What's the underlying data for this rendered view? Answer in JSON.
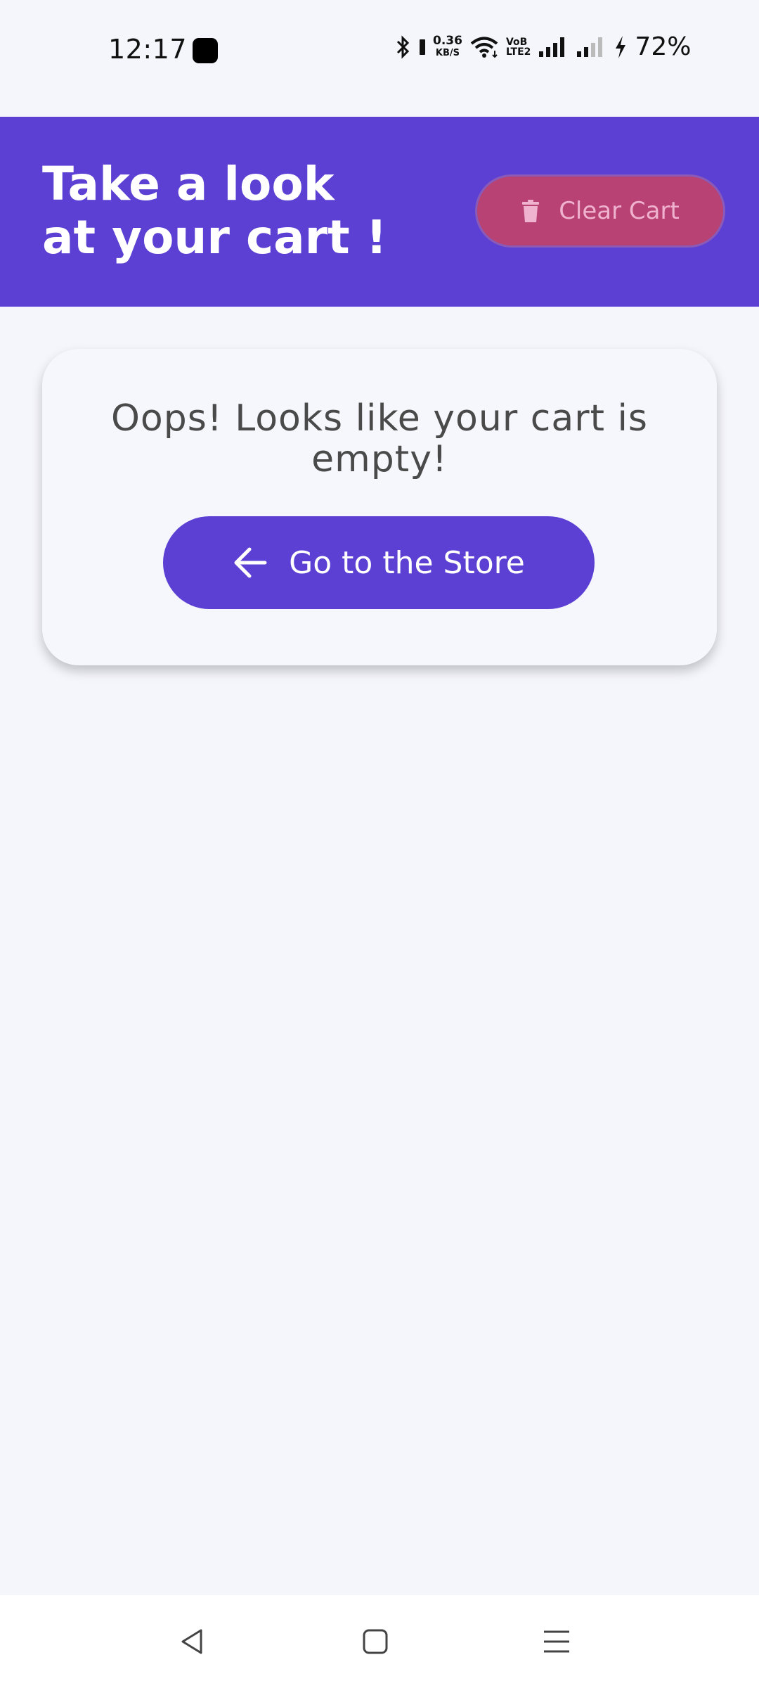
{
  "status_bar": {
    "time": "12:17",
    "net_speed_value": "0.36",
    "net_speed_unit": "KB/S",
    "volte_top": "VoB",
    "volte_bottom": "LTE2",
    "battery": "72%"
  },
  "header": {
    "title_line1": "Take a look",
    "title_line2": "at your cart !",
    "clear_cart_label": "Clear Cart"
  },
  "cart": {
    "empty_message": "Oops! Looks like your cart is empty!",
    "store_button_label": "Go to the Store"
  },
  "icons": {
    "trash": "trash-icon",
    "back_arrow": "arrow-left-icon",
    "nav_back": "nav-back-icon",
    "nav_home": "nav-home-icon",
    "nav_menu": "nav-menu-icon"
  },
  "colors": {
    "primary": "#5c3fd3",
    "clear_cart_bg": "#b84274",
    "clear_cart_text": "#f0b3cf",
    "background": "#f5f6fc"
  }
}
